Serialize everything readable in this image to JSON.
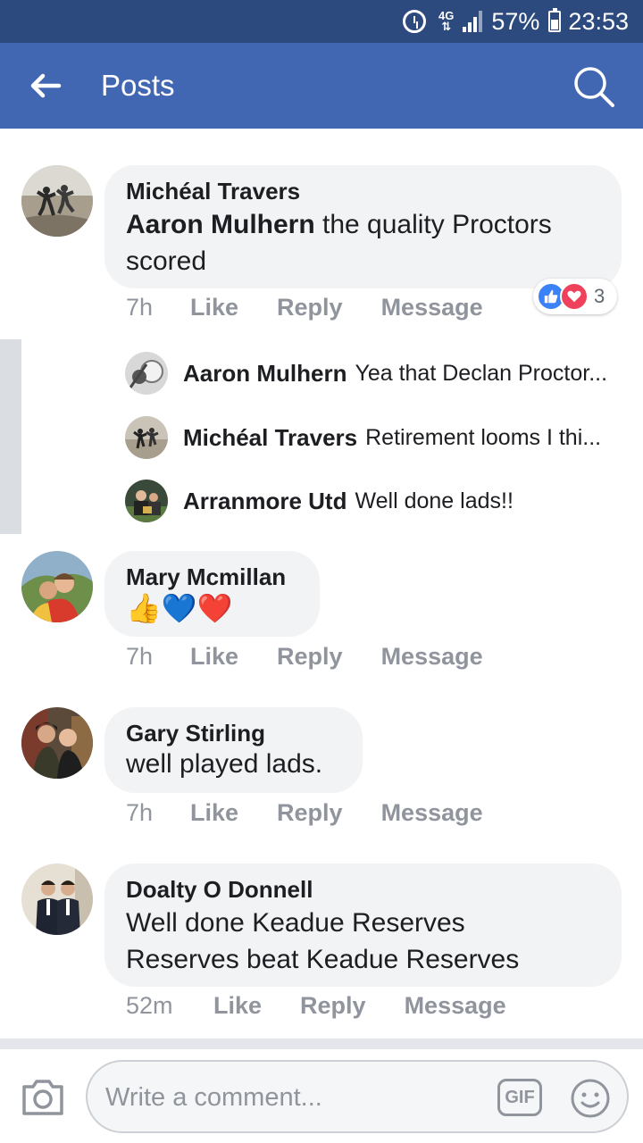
{
  "status_bar": {
    "network": "4G",
    "battery": "57%",
    "time": "23:53"
  },
  "header": {
    "title": "Posts"
  },
  "comments": [
    {
      "author": "Michéal Travers",
      "mention": "Aaron Mulhern",
      "text_line1": " the quality Proctors",
      "text_line2": "scored",
      "time": "7h",
      "reaction_count": "3"
    },
    {
      "author": "Mary Mcmillan",
      "emojis": "👍💙❤️",
      "time": "7h"
    },
    {
      "author": "Gary Stirling",
      "text": "well played lads.",
      "time": "7h"
    },
    {
      "author": "Doalty O Donnell",
      "text_line1": "Well done Keadue Reserves",
      "text_line2": "Reserves beat Keadue Reserves",
      "time": "52m"
    }
  ],
  "replies": [
    {
      "author": "Aaron Mulhern",
      "text": "Yea that Declan Proctor..."
    },
    {
      "author": "Michéal Travers",
      "text": "Retirement looms I thi..."
    },
    {
      "author": "Arranmore Utd",
      "text": "Well done lads!!"
    }
  ],
  "actions": {
    "like": "Like",
    "reply": "Reply",
    "message": "Message"
  },
  "composer": {
    "placeholder": "Write a comment...",
    "gif_label": "GIF"
  },
  "colors": {
    "status_bar": "#2c4a7e",
    "app_bar": "#4267b2",
    "bubble": "#f2f3f5",
    "muted": "#90949c"
  },
  "icons": [
    "back-arrow-icon",
    "search-icon",
    "like-reaction-icon",
    "love-reaction-icon",
    "camera-icon",
    "gif-icon",
    "emoji-icon"
  ]
}
